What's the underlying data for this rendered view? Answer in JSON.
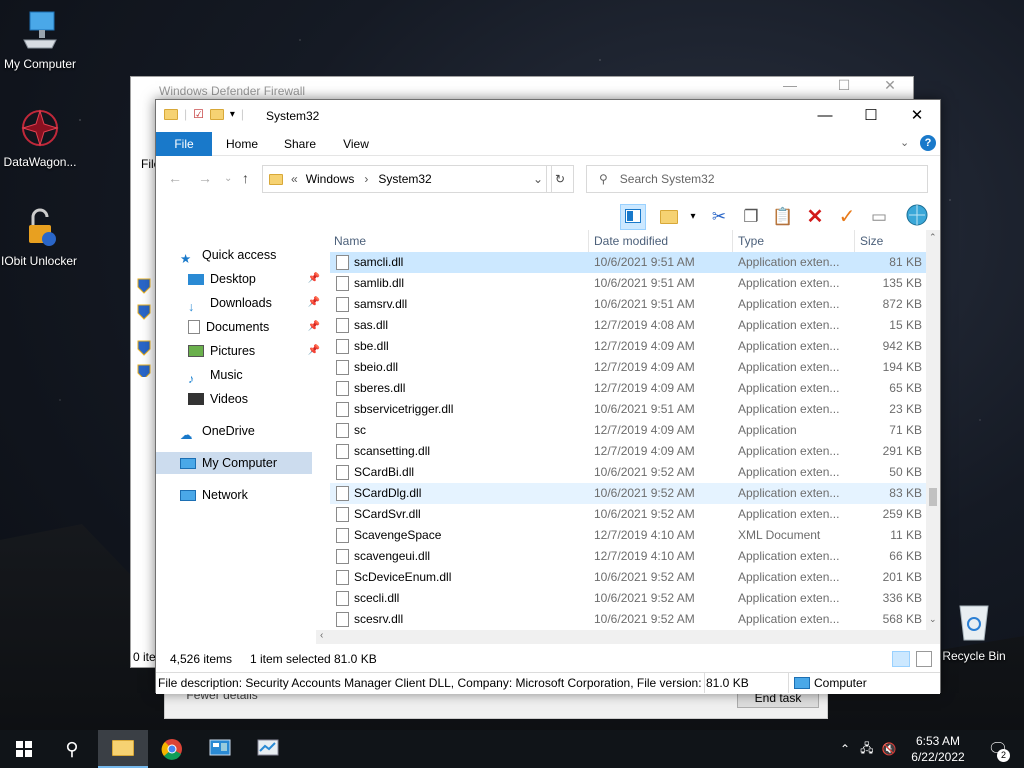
{
  "desktop": {
    "icons": [
      {
        "label": "My Computer"
      },
      {
        "label": "DataWagon..."
      },
      {
        "label": "IObit Unlocker"
      },
      {
        "label": "Recycle Bin"
      }
    ]
  },
  "bg_window": {
    "title": "Windows Defender Firewall",
    "left_label_1": "File",
    "left_label_2": "0 ite",
    "fewer_details": "Fewer details",
    "end_task": "End task"
  },
  "explorer": {
    "title": "System32",
    "tabs": [
      "File",
      "Home",
      "Share",
      "View"
    ],
    "breadcrumb": [
      "Windows",
      "System32"
    ],
    "search_placeholder": "Search System32",
    "nav": {
      "quick_access": "Quick access",
      "desktop": "Desktop",
      "downloads": "Downloads",
      "documents": "Documents",
      "pictures": "Pictures",
      "music": "Music",
      "videos": "Videos",
      "onedrive": "OneDrive",
      "my_computer": "My Computer",
      "network": "Network"
    },
    "columns": {
      "name": "Name",
      "date": "Date modified",
      "type": "Type",
      "size": "Size"
    },
    "files": [
      {
        "name": "samcli.dll",
        "date": "10/6/2021 9:51 AM",
        "type": "Application exten...",
        "size": "81 KB"
      },
      {
        "name": "samlib.dll",
        "date": "10/6/2021 9:51 AM",
        "type": "Application exten...",
        "size": "135 KB"
      },
      {
        "name": "samsrv.dll",
        "date": "10/6/2021 9:51 AM",
        "type": "Application exten...",
        "size": "872 KB"
      },
      {
        "name": "sas.dll",
        "date": "12/7/2019 4:08 AM",
        "type": "Application exten...",
        "size": "15 KB"
      },
      {
        "name": "sbe.dll",
        "date": "12/7/2019 4:09 AM",
        "type": "Application exten...",
        "size": "942 KB"
      },
      {
        "name": "sbeio.dll",
        "date": "12/7/2019 4:09 AM",
        "type": "Application exten...",
        "size": "194 KB"
      },
      {
        "name": "sberes.dll",
        "date": "12/7/2019 4:09 AM",
        "type": "Application exten...",
        "size": "65 KB"
      },
      {
        "name": "sbservicetrigger.dll",
        "date": "10/6/2021 9:51 AM",
        "type": "Application exten...",
        "size": "23 KB"
      },
      {
        "name": "sc",
        "date": "12/7/2019 4:09 AM",
        "type": "Application",
        "size": "71 KB"
      },
      {
        "name": "scansetting.dll",
        "date": "12/7/2019 4:09 AM",
        "type": "Application exten...",
        "size": "291 KB"
      },
      {
        "name": "SCardBi.dll",
        "date": "10/6/2021 9:52 AM",
        "type": "Application exten...",
        "size": "50 KB"
      },
      {
        "name": "SCardDlg.dll",
        "date": "10/6/2021 9:52 AM",
        "type": "Application exten...",
        "size": "83 KB"
      },
      {
        "name": "SCardSvr.dll",
        "date": "10/6/2021 9:52 AM",
        "type": "Application exten...",
        "size": "259 KB"
      },
      {
        "name": "ScavengeSpace",
        "date": "12/7/2019 4:10 AM",
        "type": "XML Document",
        "size": "11 KB"
      },
      {
        "name": "scavengeui.dll",
        "date": "12/7/2019 4:10 AM",
        "type": "Application exten...",
        "size": "66 KB"
      },
      {
        "name": "ScDeviceEnum.dll",
        "date": "10/6/2021 9:52 AM",
        "type": "Application exten...",
        "size": "201 KB"
      },
      {
        "name": "scecli.dll",
        "date": "10/6/2021 9:52 AM",
        "type": "Application exten...",
        "size": "336 KB"
      },
      {
        "name": "scesrv.dll",
        "date": "10/6/2021 9:52 AM",
        "type": "Application exten...",
        "size": "568 KB"
      }
    ],
    "status": {
      "items": "4,526 items",
      "selected": "1 item selected",
      "selected_size": "81.0 KB"
    },
    "infobar": {
      "description": "File description: Security Accounts Manager Client DLL, Company: Microsoft Corporation, File version:",
      "size": "81.0 KB",
      "location": "Computer"
    }
  },
  "taskbar": {
    "time": "6:53 AM",
    "date": "6/22/2022",
    "notification_count": "2"
  }
}
